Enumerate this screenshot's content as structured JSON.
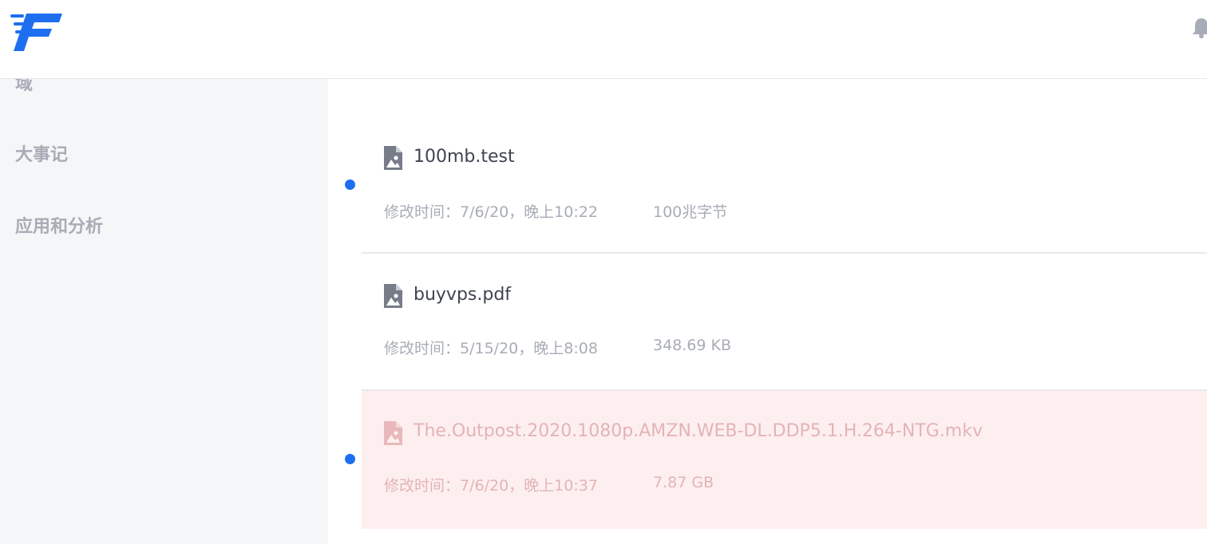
{
  "sidebar": {
    "items": [
      {
        "label": "域"
      },
      {
        "label": "大事记"
      },
      {
        "label": "应用和分析"
      }
    ]
  },
  "files": [
    {
      "name": "100mb.test",
      "modified": "修改时间：7/6/20，晚上10:22",
      "size": "100兆字节",
      "highlighted": false,
      "marked": true
    },
    {
      "name": "buyvps.pdf",
      "modified": "修改时间：5/15/20，晚上8:08",
      "size": "348.69 KB",
      "highlighted": false,
      "marked": false
    },
    {
      "name": "The.Outpost.2020.1080p.AMZN.WEB-DL.DDP5.1.H.264-NTG.mkv",
      "modified": "修改时间：7/6/20，晚上10:37",
      "size": "7.87 GB",
      "highlighted": true,
      "marked": true
    }
  ],
  "icons": {
    "logo": "brand-f-logo",
    "notification": "bell-icon",
    "file": "image-file-icon"
  },
  "colors": {
    "brand": "#1e6ff0",
    "highlight_bg": "#fdefef",
    "muted_text": "#a8acb6",
    "primary_text": "#3f4452"
  }
}
